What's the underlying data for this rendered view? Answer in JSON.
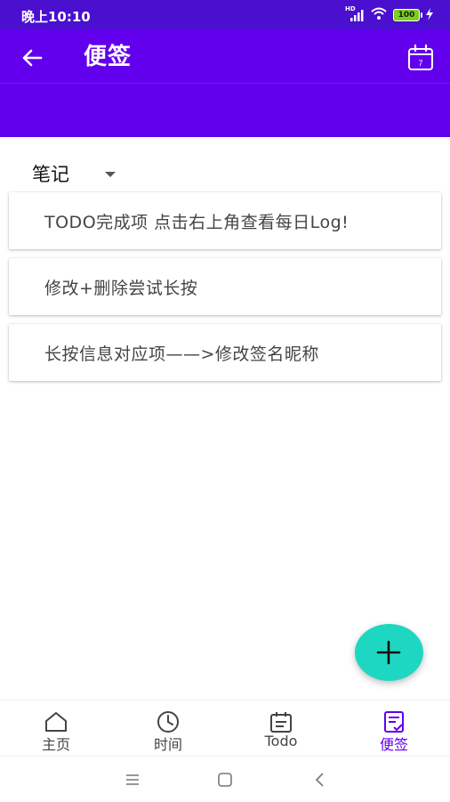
{
  "status_bar": {
    "time": "晚上10:10",
    "network": "HD",
    "battery": "100"
  },
  "app_bar": {
    "title": "便签",
    "calendar_day": "7"
  },
  "category": {
    "selected": "笔记"
  },
  "notes": [
    {
      "text": "TODO完成项 点击右上角查看每日Log!"
    },
    {
      "text": "修改+删除尝试长按"
    },
    {
      "text": "长按信息对应项——>修改签名昵称"
    }
  ],
  "bottom_nav": {
    "items": [
      {
        "label": "主页",
        "icon": "home-icon"
      },
      {
        "label": "时间",
        "icon": "clock-icon"
      },
      {
        "label": "Todo",
        "icon": "todo-calendar-icon"
      },
      {
        "label": "便签",
        "icon": "note-icon"
      }
    ],
    "active": "便签"
  },
  "colors": {
    "primary": "#6200ee",
    "status_bar": "#4a0fcf",
    "fab": "#1ed7c3"
  }
}
